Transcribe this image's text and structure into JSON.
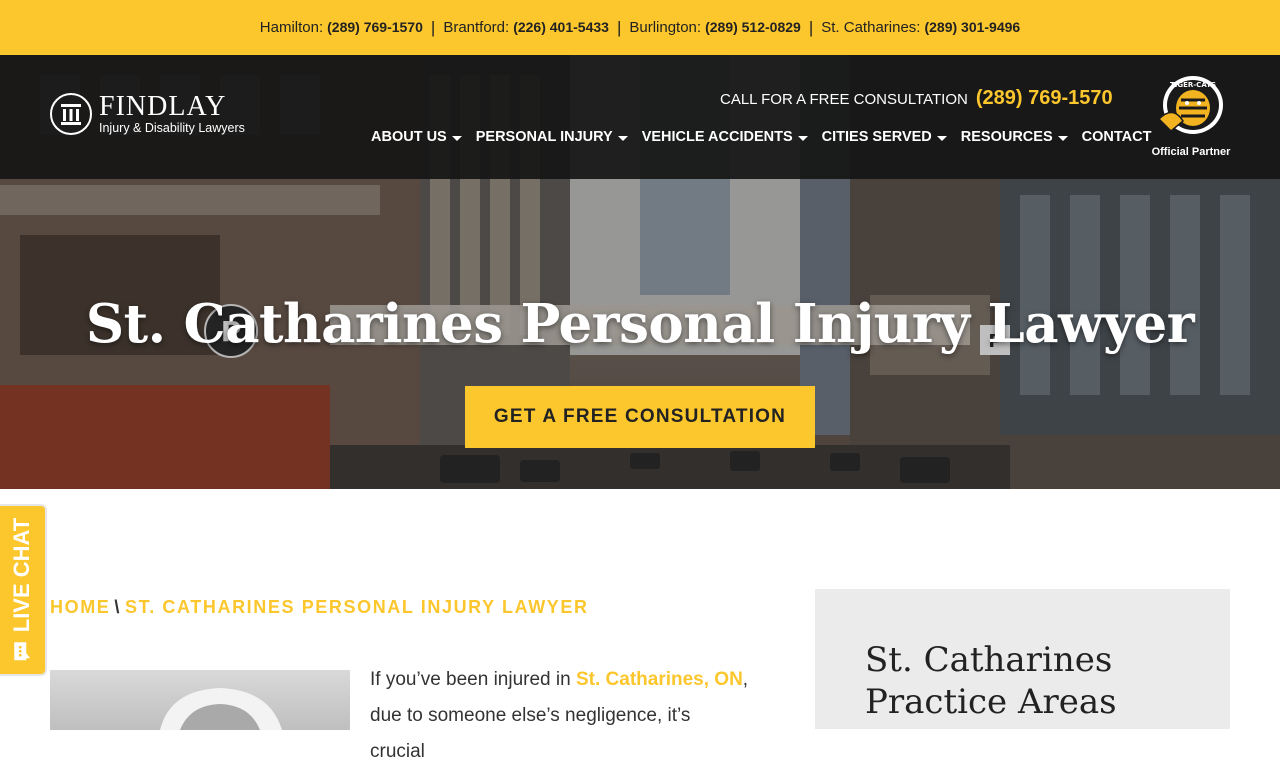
{
  "phones": [
    {
      "city": "Hamilton:",
      "number": "(289) 769-1570"
    },
    {
      "city": "Brantford:",
      "number": "(226) 401-5433"
    },
    {
      "city": "Burlington:",
      "number": "(289) 512-0829"
    },
    {
      "city": "St. Catharines:",
      "number": "(289) 301-9496"
    }
  ],
  "phone_separator": "|",
  "logo": {
    "name": "FINDLAY",
    "sub": "Injury & Disability Lawyers"
  },
  "cta": {
    "label": "CALL FOR A FREE CONSULTATION",
    "number": "(289) 769-1570"
  },
  "nav": [
    {
      "label": "ABOUT US",
      "dropdown": true
    },
    {
      "label": "PERSONAL INJURY",
      "dropdown": true
    },
    {
      "label": "VEHICLE ACCIDENTS",
      "dropdown": true
    },
    {
      "label": "CITIES SERVED",
      "dropdown": true
    },
    {
      "label": "RESOURCES",
      "dropdown": true
    },
    {
      "label": "CONTACT",
      "dropdown": false
    }
  ],
  "partner": {
    "label": "Official Partner",
    "badge_text": "TIGER-CATS"
  },
  "hero": {
    "title": "St. Catharines Personal Injury Lawyer",
    "button": "GET A FREE CONSULTATION"
  },
  "livechat": {
    "label": "LIVE CHAT"
  },
  "breadcrumb": {
    "home": "HOME",
    "separator": "\\",
    "current": "ST. CATHARINES PERSONAL INJURY LAWYER"
  },
  "intro": {
    "before": "If you’ve been injured in ",
    "highlight": "St. Catharines, ON",
    "after": ",",
    "line2": "due to someone else’s negligence, it’s crucial"
  },
  "sidebar": {
    "title_line1": "St. Catharines",
    "title_line2": "Practice Areas"
  },
  "colors": {
    "accent": "#fcc62d",
    "header": "#161616",
    "sidebar_bg": "#ebebeb"
  }
}
